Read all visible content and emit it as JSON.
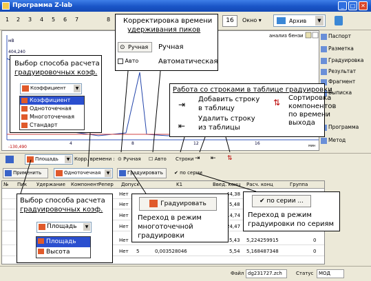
{
  "window": {
    "title": "Программа Z-lab"
  },
  "toolbar": {
    "tabs": [
      "1",
      "2",
      "3",
      "4",
      "5",
      "6",
      "7",
      "8"
    ],
    "tool16": "16",
    "okno": "Окно",
    "archive": "Архив"
  },
  "plot": {
    "unit": "мВ",
    "y_top": "404,240",
    "y_bottom": "-130,490",
    "x_ticks": [
      "4",
      "8",
      "12",
      "16"
    ],
    "x_unit": "мин",
    "analysis_name": "анализ бензи"
  },
  "right_panel": {
    "items": [
      "Паспорт",
      "Разметка",
      "Градуировка",
      "Результат",
      "Фрагмент",
      "Выписка",
      "Программа",
      "Метод"
    ]
  },
  "toolbar2": {
    "area_combo": "Площадь",
    "corr_label": "Корр. времени :",
    "manual": "Ручная",
    "auto": "Авто",
    "rows": "Строки"
  },
  "toolbar3": {
    "apply": "Применить",
    "single_point": "Одноточечная",
    "calibrate": "Градуировать",
    "by_series": "по серии"
  },
  "table": {
    "headers": [
      "№",
      "Пик",
      "Удержание",
      "Компонент",
      "Репер",
      "Допуск",
      "K1",
      "Введ. конц",
      "Расч. конц",
      "Группа"
    ],
    "rows": [
      {
        "reper": "Нет",
        "k1": "",
        "vved": "44,38",
        "rasch": "",
        "group": ""
      },
      {
        "reper": "Нет",
        "k1": "",
        "vved": "5,48",
        "rasch": "",
        "group": ""
      },
      {
        "reper": "Нет",
        "k1": "",
        "vved": "14,74",
        "rasch": "",
        "group": ""
      },
      {
        "reper": "Нет",
        "k1": "",
        "vved": "24,47",
        "rasch": "",
        "group": ""
      },
      {
        "reper": "Нет",
        "k1": "",
        "vved": "5,43",
        "rasch": "5,224259915",
        "group": "0"
      },
      {
        "reper": "Нет",
        "dopusk": "5",
        "k1": "0,003528046",
        "vved": "5,54",
        "rasch": "5,168487348",
        "group": "0"
      }
    ]
  },
  "status": {
    "file_label": "Файл",
    "file_name": "dg231727.zch",
    "status_label": "Статус",
    "status_value": "МОД"
  },
  "callouts": {
    "calib_method_top": {
      "title_line1": "Выбор способа расчета",
      "title_line2": "градуировочных коэф.",
      "combo": "Коэффициент",
      "options": [
        "Коэффициент",
        "Одноточечная",
        "Многоточечная",
        "Стандарт"
      ]
    },
    "retention": {
      "title_line1": "Корректировка времени",
      "title_line2": "удерживания пиков",
      "btn_manual": "Ручная",
      "manual_text": "Ручная",
      "btn_auto": "Авто",
      "auto_text": "Автоматическая"
    },
    "rows": {
      "title": "Работа со строками в таблице градуировки",
      "add": [
        "Добавить строку",
        "в таблицу"
      ],
      "remove": [
        "Удалить строку",
        "из таблицы"
      ],
      "sort": [
        "Сортировка",
        "компонентов",
        "по времени",
        "выхода"
      ]
    },
    "calib_method_bottom": {
      "title_line1": "Выбор способа расчета",
      "title_line2": "градуировочных коэф.",
      "combo": "Площадь",
      "options": [
        "Площадь",
        "Высота"
      ]
    },
    "multipoint": {
      "button": "Градуировать",
      "text": [
        "Переход в режим",
        "многоточечной",
        "градуировки"
      ]
    },
    "series": {
      "button": "по серии ...",
      "text": [
        "Переход в режим",
        "градуировки по сериям"
      ]
    }
  }
}
